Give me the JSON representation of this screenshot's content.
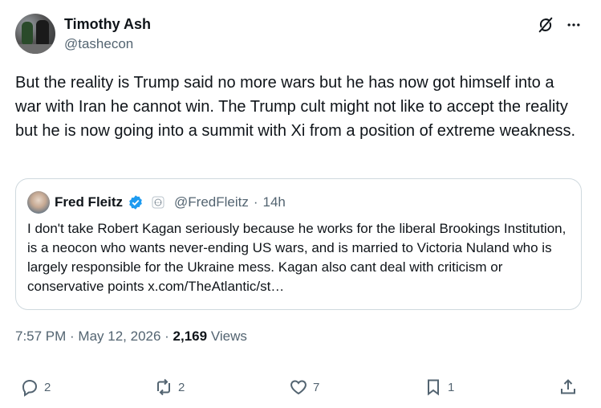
{
  "tweet": {
    "author_name": "Timothy Ash",
    "author_handle": "@tashecon",
    "text": "But the reality is Trump said no more wars but he has now got himself into a war with Iran he cannot win. The Trump cult might not like to accept the reality but he is now going into a summit with Xi from a position of extreme weakness.",
    "time": "7:57 PM · May 12, 2026 · ",
    "views_count": "2,169",
    "views_label": " Views"
  },
  "quoted": {
    "author_name": "Fred Fleitz",
    "author_handle": "@FredFleitz",
    "separator": "·",
    "age": "14h",
    "text": "I don't take Robert Kagan seriously because he works for the liberal Brookings Institution, is a neocon who wants never-ending US wars, and is married to Victoria Nuland who is largely responsible for the Ukraine mess.  Kagan also cant deal with criticism or conservative points x.com/TheAtlantic/st…"
  },
  "actions": {
    "replies": "2",
    "reposts": "2",
    "likes": "7",
    "bookmarks": "1"
  },
  "colors": {
    "verified": "#1d9bf0",
    "muted_text": "#536471",
    "border": "#cfd9de"
  },
  "icons": [
    "grok-icon",
    "more-icon",
    "verified-badge-icon",
    "affiliate-badge-icon",
    "reply-icon",
    "repost-icon",
    "like-icon",
    "bookmark-icon",
    "share-icon"
  ]
}
